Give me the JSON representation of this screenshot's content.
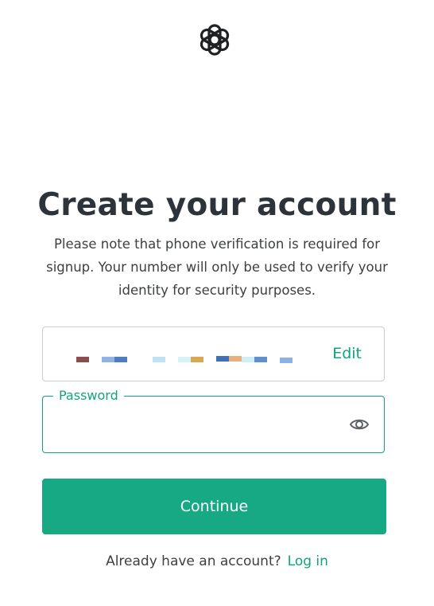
{
  "brand": {
    "logo_icon": "openai-logo-icon",
    "accent_color": "#10a37f",
    "button_color": "#17a884"
  },
  "header": {
    "title": "Create your account",
    "subtitle": "Please note that phone verification is required for signup. Your number will only be used to verify your identity for security purposes."
  },
  "identifier_field": {
    "value_redacted": true,
    "edit_label": "Edit"
  },
  "password_field": {
    "label": "Password",
    "value": "",
    "toggle_icon": "eye-icon"
  },
  "actions": {
    "continue_label": "Continue"
  },
  "footer": {
    "prompt": "Already have an account?",
    "login_label": "Log in"
  }
}
